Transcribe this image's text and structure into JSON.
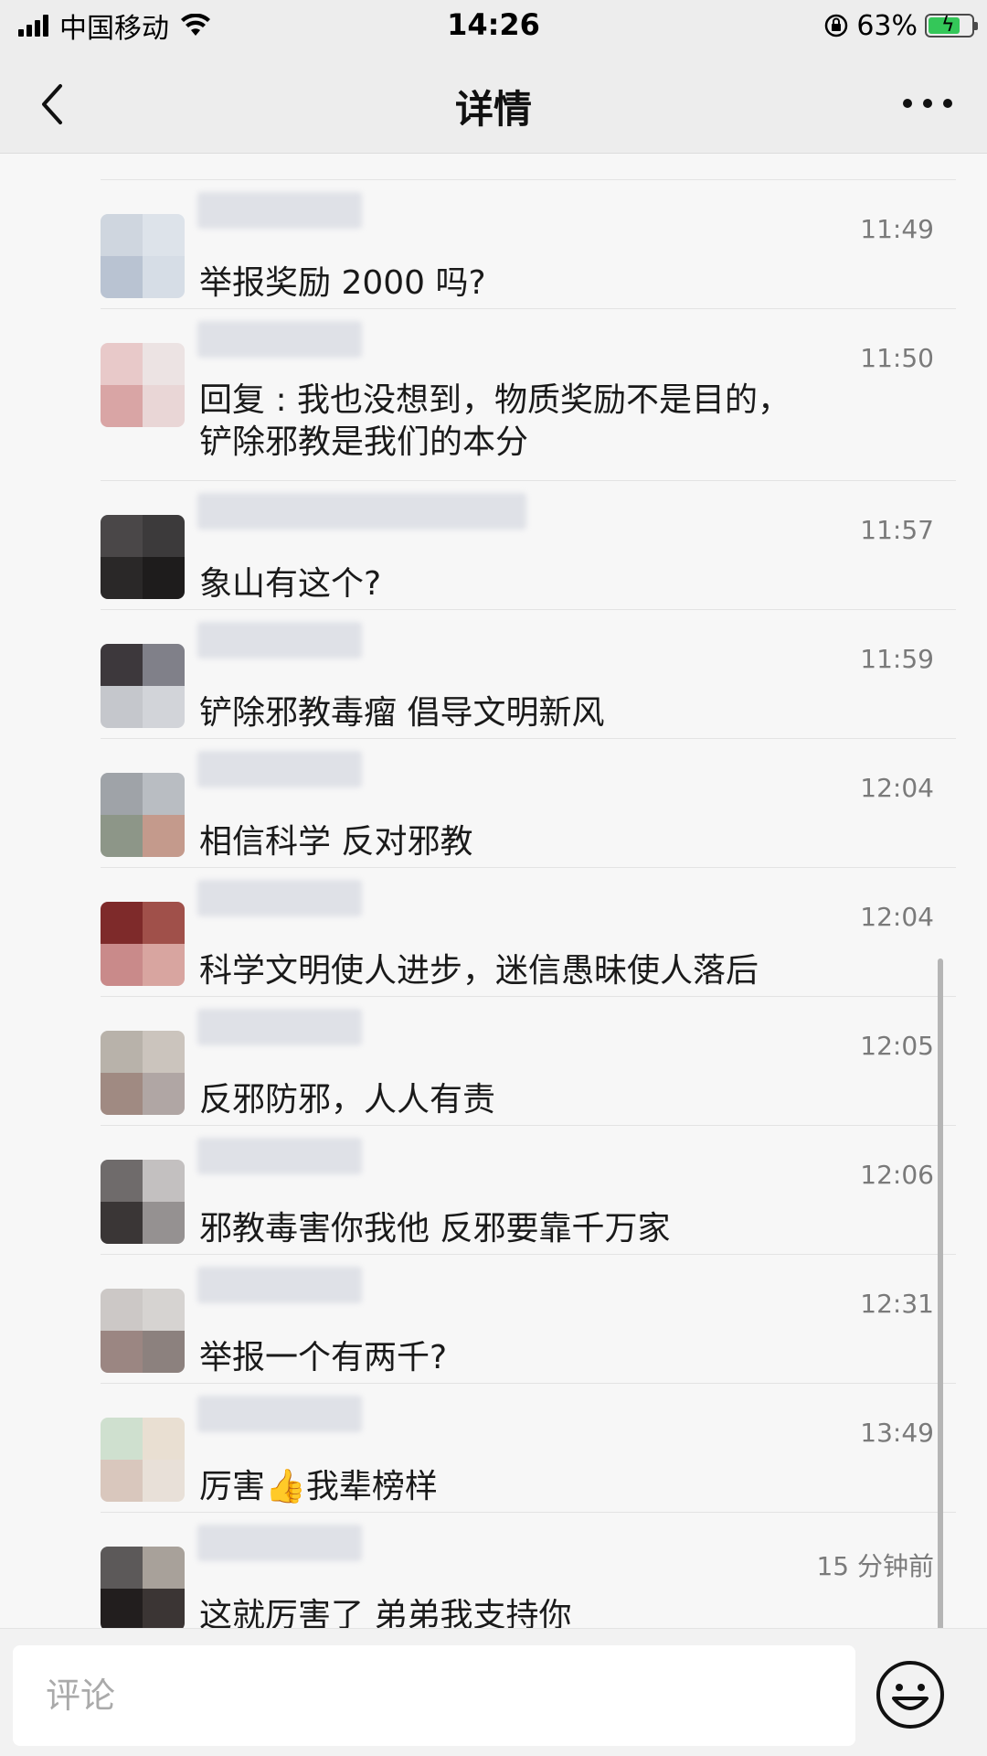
{
  "status_bar": {
    "carrier": "中国移动",
    "time": "14:26",
    "battery": "63%"
  },
  "nav": {
    "title": "详情"
  },
  "comments": [
    {
      "time": "11:49",
      "text": "举报奖励 2000 吗?"
    },
    {
      "time": "11:50",
      "text": "回复  : 我也没想到，物质奖励不是目的，",
      "text2": "铲除邪教是我们的本分"
    },
    {
      "time": "11:57",
      "text": "象山有这个?"
    },
    {
      "time": "11:59",
      "text": "铲除邪教毒瘤 倡导文明新风"
    },
    {
      "time": "12:04",
      "text": "相信科学 反对邪教"
    },
    {
      "time": "12:04",
      "text": "科学文明使人进步，迷信愚昧使人落后"
    },
    {
      "time": "12:05",
      "text": "反邪防邪，人人有责"
    },
    {
      "time": "12:06",
      "text": "邪教毒害你我他 反邪要靠千万家"
    },
    {
      "time": "12:31",
      "text": "举报一个有两千?"
    },
    {
      "time": "13:49",
      "text": "厉害👍我辈榜样"
    },
    {
      "time": "15 分钟前",
      "text": "这就厉害了   弟弟我支持你"
    }
  ],
  "input": {
    "placeholder": "评论"
  },
  "colors": {
    "background": "#f7f7f7",
    "bar": "#ededed",
    "battery_green": "#34c759"
  }
}
